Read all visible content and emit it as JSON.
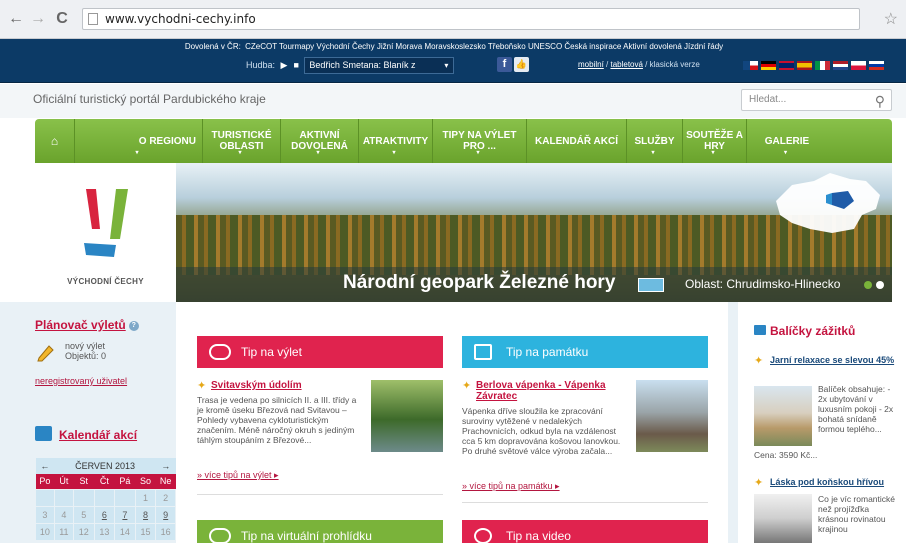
{
  "browser": {
    "back_icon": "←",
    "forward_icon": "→",
    "reload_icon": "C",
    "url": "www.vychodni-cechy.info",
    "bookmark_icon": "☆"
  },
  "topbar": {
    "label": "Dovolená v ČR:",
    "links": [
      "CZeCOT",
      "Tourmapy",
      "Východní Čechy",
      "Jižní Morava",
      "Moravskoslezsko",
      "Třeboňsko",
      "UNESCO",
      "Česká inspirace",
      "Aktivní dovolená",
      "Jízdní řády"
    ],
    "music_label": "Hudba:",
    "music_play": "▶",
    "music_stop": "■",
    "music_track": "Bedřich Smetana: Blaník z",
    "music_caret": "▾",
    "fb": "f",
    "like": "👍",
    "mobile": "mobilní",
    "sep1": " / ",
    "tablet": "tabletová",
    "sep2": " / ",
    "classic": "klasická verze"
  },
  "header": {
    "tagline": "Oficiální turistický portál Pardubického kraje",
    "search_placeholder": "Hledat...",
    "search_icon": "⚲"
  },
  "nav": {
    "home": "⌂",
    "items": [
      {
        "label": "O REGIONU"
      },
      {
        "label": "TURISTICKÉ OBLASTI"
      },
      {
        "label": "AKTIVNÍ DOVOLENÁ"
      },
      {
        "label": "ATRAKTIVITY"
      },
      {
        "label": "TIPY NA VÝLET PRO ..."
      },
      {
        "label": "KALENDÁŘ AKCÍ"
      },
      {
        "label": "SLUŽBY"
      },
      {
        "label": "SOUTĚŽE A HRY"
      },
      {
        "label": "GALERIE"
      }
    ],
    "arrow": "▾"
  },
  "hero": {
    "logo_text": "VÝCHODNÍ ČECHY",
    "title": "Národní geopark Železné hory",
    "region": "Oblast: Chrudimsko-Hlinecko"
  },
  "planner": {
    "title": "Plánovač výletů",
    "help": "?",
    "new_trip": "nový výlet",
    "objects": "Objektů: 0",
    "unregistered": "neregistrovaný uživatel"
  },
  "calendar": {
    "title": "Kalendář akcí",
    "prev": "←",
    "month": "ČERVEN 2013",
    "next": "→",
    "days": [
      "Po",
      "Út",
      "St",
      "Čt",
      "Pá",
      "So",
      "Ne"
    ],
    "rows": [
      [
        "",
        "",
        "",
        "",
        "",
        "1",
        "2"
      ],
      [
        "3",
        "4",
        "5",
        "6",
        "7",
        "8",
        "9"
      ],
      [
        "10",
        "11",
        "12",
        "13",
        "14",
        "15",
        "16"
      ]
    ]
  },
  "tips": [
    {
      "bar": "Tip na výlet",
      "title": "Svitavským údolím",
      "desc": "Trasa je vedena po silnicích II. a III. třídy a je kromě úseku Březová nad Svitavou – Pohledy vybavena cykloturistickým značením. Méně náročný okruh s jediným táhlým stoupáním z Březové...",
      "more": "» více tipů na výlet ▸"
    },
    {
      "bar": "Tip na památku",
      "title": "Berlova vápenka - Vápenka Závratec",
      "desc": "Vápenka dříve sloužila ke zpracování suroviny vytěžené v nedalekých Prachovnicích, odkud byla na vzdálenost cca 5 km dopravována košovou lanovkou. Po druhé světové válce výroba začala...",
      "more": "» více tipů na památku ▸"
    },
    {
      "bar": "Tip na virtuální prohlídku"
    },
    {
      "bar": "Tip na video"
    }
  ],
  "packages": {
    "title": "Balíčky zážitků",
    "items": [
      {
        "title": "Jarní relaxace se slevou 45%",
        "desc": "Balíček obsahuje: - 2x ubytování v luxusním pokoji - 2x bohatá snídaně formou teplého...",
        "price": "Cena: 3590 Kč..."
      },
      {
        "title": "Láska pod koňskou hřívou",
        "desc": "Co je víc romantické než projížďka krásnou rovinatou krajinou"
      }
    ]
  },
  "colors": {
    "accent": "#c4133f",
    "nav_green": "#7ab33a",
    "tip_red": "#e0234e",
    "tip_blue": "#2db3de",
    "tip_green": "#7ab33a"
  }
}
